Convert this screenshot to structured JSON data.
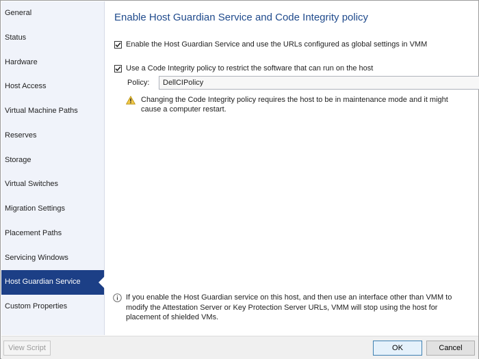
{
  "sidebar": {
    "items": [
      {
        "label": "General",
        "selected": false
      },
      {
        "label": "Status",
        "selected": false
      },
      {
        "label": "Hardware",
        "selected": false
      },
      {
        "label": "Host Access",
        "selected": false
      },
      {
        "label": "Virtual Machine Paths",
        "selected": false
      },
      {
        "label": "Reserves",
        "selected": false
      },
      {
        "label": "Storage",
        "selected": false
      },
      {
        "label": "Virtual Switches",
        "selected": false
      },
      {
        "label": "Migration Settings",
        "selected": false
      },
      {
        "label": "Placement Paths",
        "selected": false
      },
      {
        "label": "Servicing Windows",
        "selected": false
      },
      {
        "label": "Host Guardian Service",
        "selected": true
      },
      {
        "label": "Custom Properties",
        "selected": false
      }
    ]
  },
  "main": {
    "title": "Enable Host Guardian Service and Code Integrity policy",
    "hgs_checkbox": {
      "label": "Enable the Host Guardian Service and use the URLs configured as global settings in VMM",
      "checked": true
    },
    "ci_checkbox": {
      "label": "Use a Code Integrity policy to restrict the software that can run on the host",
      "checked": true
    },
    "policy": {
      "label": "Policy:",
      "value": "DellCIPolicy"
    },
    "warning": {
      "line1": "Changing the Code Integrity policy requires the host to be in maintenance mode and it might",
      "line2": "cause a computer restart."
    },
    "info": {
      "line1": "If you enable the Host Guardian service on this host, and then use an interface other than VMM to",
      "line2": "modify the Attestation Server or Key Protection Server URLs, VMM will stop using the host for",
      "line3": "placement of shielded VMs."
    }
  },
  "footer": {
    "view_script": "View Script",
    "ok": "OK",
    "cancel": "Cancel"
  },
  "colors": {
    "selected_bg": "#1c3f86",
    "title": "#1f4a8c",
    "sidebar_bg": "#f0f3fa"
  }
}
